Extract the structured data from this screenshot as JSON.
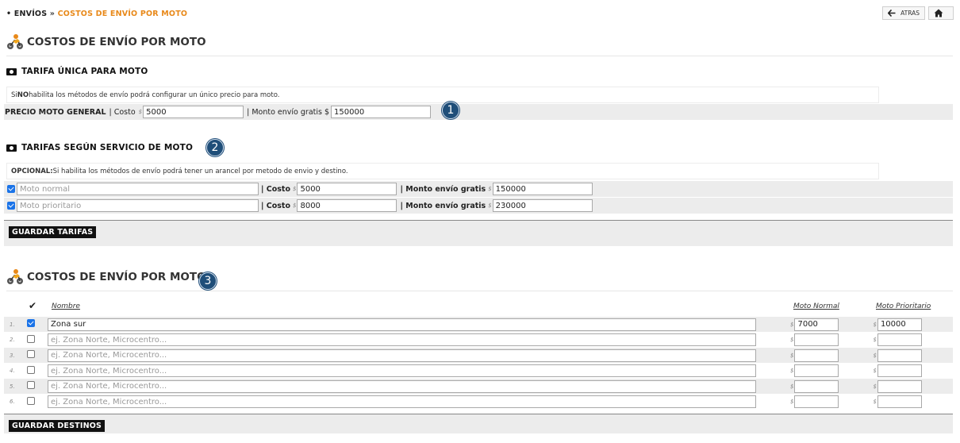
{
  "breadcrumb": {
    "bullet": "•",
    "root": "ENVÍOS",
    "separator": "»",
    "current": "COSTOS DE ENVÍO POR MOTO"
  },
  "toolbar": {
    "back_label": "ATRAS"
  },
  "page_title": "COSTOS DE ENVÍO POR MOTO",
  "tarifa_unica": {
    "heading": "TARIFA ÚNICA PARA MOTO",
    "note_prefix": "Si ",
    "note_bold": "NO",
    "note_rest": " habilita los métodos de envío podrá configurar un único precio para moto.",
    "label": "PRECIO MOTO GENERAL",
    "costo_label": "| Costo",
    "currency": "$",
    "costo_value": "5000",
    "gratis_label": "| Monto envío gratis $",
    "gratis_value": "150000",
    "badge": "1"
  },
  "tarifas_servicio": {
    "heading": "TARIFAS SEGÚN SERVICIO DE MOTO",
    "badge": "2",
    "note_bold": "OPCIONAL:",
    "note_rest": " Si habilita los métodos de envío podrá tener un arancel por metodo de envio y destino.",
    "costo_label": "| Costo",
    "gratis_label": "| Monto envío gratis",
    "currency": "$",
    "services": [
      {
        "placeholder": "Moto normal",
        "checked": true,
        "costo": "5000",
        "gratis": "150000"
      },
      {
        "placeholder": "Moto prioritario",
        "checked": true,
        "costo": "8000",
        "gratis": "230000"
      }
    ],
    "save_label": "GUARDAR TARIFAS"
  },
  "destinos": {
    "heading": "COSTOS DE ENVÍO POR MOTO",
    "badge": "3",
    "check_header": "✔",
    "col_name": "Nombre",
    "col_normal": "Moto Normal",
    "col_prioritario": "Moto Prioritario",
    "currency": "$",
    "placeholder": "ej. Zona Norte, Microcentro...",
    "rows": [
      {
        "num": "1.",
        "checked": true,
        "name": "Zona sur",
        "normal": "7000",
        "prioritario": "10000"
      },
      {
        "num": "2.",
        "checked": false,
        "name": "",
        "normal": "",
        "prioritario": ""
      },
      {
        "num": "3.",
        "checked": false,
        "name": "",
        "normal": "",
        "prioritario": ""
      },
      {
        "num": "4.",
        "checked": false,
        "name": "",
        "normal": "",
        "prioritario": ""
      },
      {
        "num": "5.",
        "checked": false,
        "name": "",
        "normal": "",
        "prioritario": ""
      },
      {
        "num": "6.",
        "checked": false,
        "name": "",
        "normal": "",
        "prioritario": ""
      }
    ],
    "save_label": "GUARDAR DESTINOS"
  }
}
